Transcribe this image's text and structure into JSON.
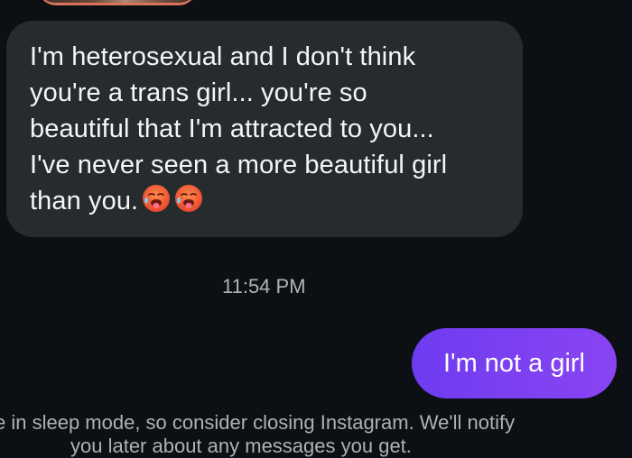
{
  "thread": {
    "incoming_message": {
      "lines": [
        "I'm heterosexual and I don't think",
        "you're a trans girl... you're so",
        "beautiful that I'm attracted to you...",
        "I've never seen a more beautiful girl",
        "than you."
      ],
      "emojis": [
        "hot-face-emoji",
        "hot-face-emoji"
      ]
    },
    "timestamp": "11:54 PM",
    "outgoing_message": {
      "text": "I'm not a girl"
    },
    "sleep_notice": {
      "line1": "e in sleep mode, so consider closing Instagram. We'll notify",
      "line2": "you later about any messages you get."
    }
  },
  "colors": {
    "background": "#0c1014",
    "incoming_bubble": "#262b2e",
    "outgoing_bubble": "#7b3ff2",
    "timestamp_text": "#b3b3b3"
  }
}
